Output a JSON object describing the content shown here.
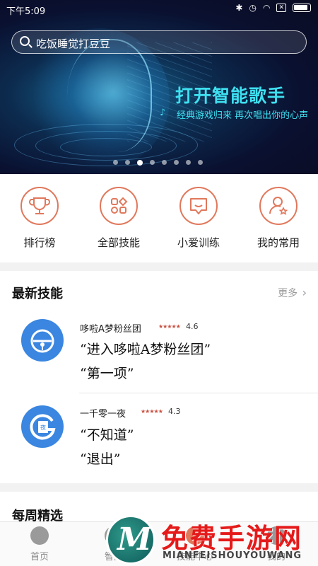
{
  "status_bar": {
    "time": "下午5:09"
  },
  "search": {
    "placeholder": "吃饭睡觉打豆豆"
  },
  "banner": {
    "title": "打开智能歌手",
    "subtitle": "经典游戏归来 再次唱出你的心声",
    "dot_count": 8,
    "active_dot": 3
  },
  "quick_menu": [
    {
      "label": "排行榜",
      "icon": "trophy-icon"
    },
    {
      "label": "全部技能",
      "icon": "grid-icon"
    },
    {
      "label": "小爱训练",
      "icon": "chat-icon"
    },
    {
      "label": "我的常用",
      "icon": "user-star-icon"
    }
  ],
  "latest": {
    "title": "最新技能",
    "more": "更多",
    "skills": [
      {
        "name": "哆啦A梦粉丝团",
        "rating": "4.6",
        "phrases": [
          "“进入哆啦A梦粉丝团”",
          "“第一项”"
        ]
      },
      {
        "name": "一千零一夜",
        "rating": "4.3",
        "phrases": [
          "“不知道”",
          "“退出”"
        ]
      }
    ]
  },
  "weekly": {
    "title": "每周精选"
  },
  "bottom_nav": [
    {
      "label": "首页"
    },
    {
      "label": "智能"
    },
    {
      "label": "技能中心"
    },
    {
      "label": "我的"
    }
  ],
  "watermark": {
    "title": "免费手游网",
    "subtitle": "MIANFEISHOUYOUWANG"
  },
  "colors": {
    "accent": "#e0785c",
    "banner_text": "#3ee0f0",
    "skill_icon": "#3a86e0"
  }
}
